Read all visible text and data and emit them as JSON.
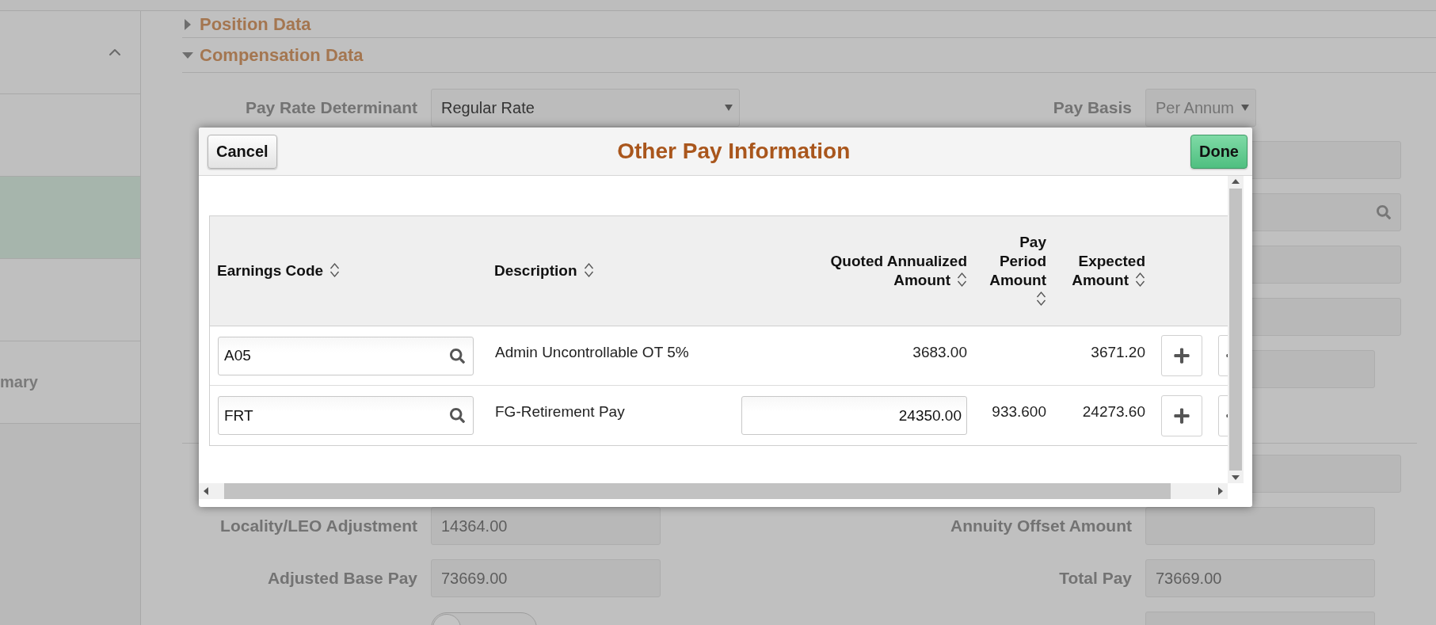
{
  "sidebar": {
    "items": [
      {
        "selected": false
      },
      {
        "selected": true
      },
      {
        "selected": false
      },
      {
        "label": "mary",
        "selected": false
      }
    ]
  },
  "sections": [
    {
      "title": "Position Data",
      "expanded": false
    },
    {
      "title": "Compensation Data",
      "expanded": true
    }
  ],
  "form": {
    "rows": [
      {
        "kind": "fields",
        "left": {
          "label": "Pay Rate Determinant",
          "kind": "select",
          "value": "Regular Rate"
        },
        "right": {
          "label": "Pay Basis",
          "kind": "select",
          "value": "Per Annum"
        }
      },
      {
        "kind": "fields",
        "right": {
          "kind": "text"
        }
      },
      {
        "kind": "fields",
        "right": {
          "kind": "search"
        }
      },
      {
        "kind": "fields",
        "right": {
          "kind": "text"
        }
      },
      {
        "kind": "fields",
        "right": {
          "kind": "text"
        }
      },
      {
        "kind": "fields",
        "right": {
          "kind": "text"
        }
      },
      {
        "kind": "divider"
      },
      {
        "kind": "fields",
        "right": {
          "kind": "text"
        }
      },
      {
        "kind": "fields",
        "left": {
          "label": "Locality/LEO Adjustment",
          "kind": "text",
          "value": "14364.00"
        },
        "right": {
          "label": "Annuity Offset Amount",
          "kind": "text"
        }
      },
      {
        "kind": "fields",
        "left": {
          "label": "Adjusted Base Pay",
          "kind": "text",
          "value": "73669.00"
        },
        "right": {
          "label": "Total Pay",
          "kind": "text",
          "value": "73669.00"
        }
      },
      {
        "kind": "fields",
        "left": {
          "kind": "toggle",
          "on": false
        },
        "right": {
          "kind": "text"
        }
      }
    ]
  },
  "modal": {
    "title": "Other Pay Information",
    "cancel": "Cancel",
    "done": "Done",
    "table": {
      "columns": [
        {
          "label": "Earnings Code"
        },
        {
          "label": "Description"
        },
        {
          "label": "Quoted Annualized Amount"
        },
        {
          "label": "Pay Period Amount"
        },
        {
          "label": "Expected Amount"
        }
      ],
      "rows": [
        {
          "earnings_code": "A05",
          "description": "Admin Uncontrollable OT 5%",
          "quoted": {
            "kind": "text",
            "value": "3683.00"
          },
          "expected": "3671.20"
        },
        {
          "earnings_code": "FRT",
          "description": "FG-Retirement Pay",
          "quoted": {
            "kind": "input",
            "value": "24350.00"
          },
          "pay_period": "933.600",
          "expected": "24273.60"
        }
      ]
    }
  }
}
